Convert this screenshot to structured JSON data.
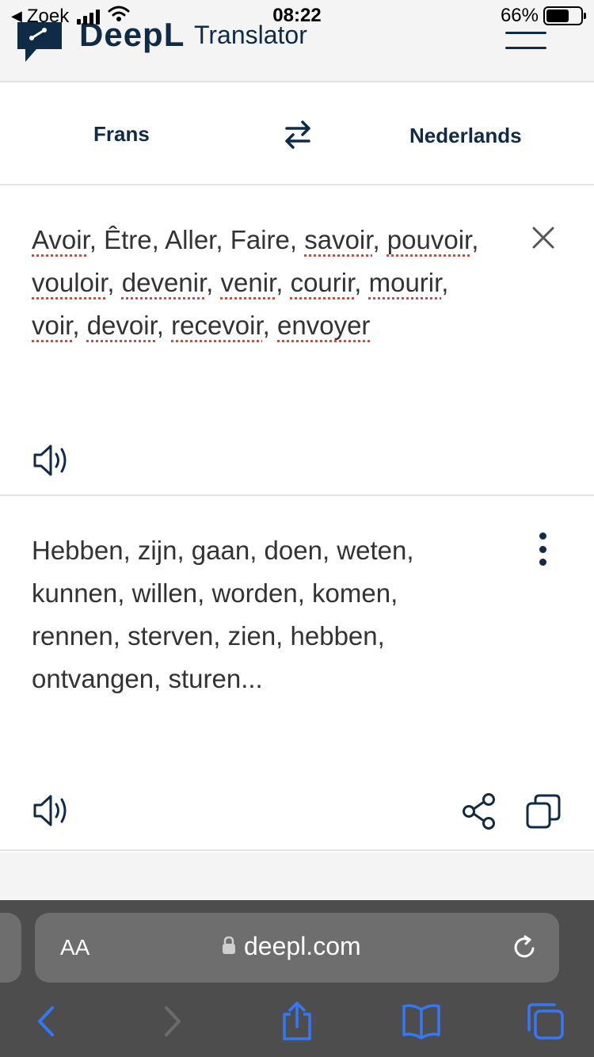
{
  "status_bar": {
    "back_label": "Zoek",
    "time": "08:22",
    "battery_percent": "66%",
    "battery_level": 0.66
  },
  "header": {
    "logo_text": "DeepL",
    "logo_subtitle": "Translator"
  },
  "languages": {
    "source": "Frans",
    "target": "Nederlands"
  },
  "source_panel": {
    "lines": [
      [
        {
          "t": "Avoir",
          "s": true
        },
        {
          "t": ", Être, Aller, Faire, ",
          "s": false
        },
        {
          "t": "savoir",
          "s": true
        },
        {
          "t": ", ",
          "s": false
        },
        {
          "t": "pouvoir",
          "s": true
        },
        {
          "t": ",",
          "s": false
        }
      ],
      [
        {
          "t": "vouloir",
          "s": true
        },
        {
          "t": ", ",
          "s": false
        },
        {
          "t": "devenir",
          "s": true
        },
        {
          "t": ", ",
          "s": false
        },
        {
          "t": "venir",
          "s": true
        },
        {
          "t": ", ",
          "s": false
        },
        {
          "t": "courir",
          "s": true
        },
        {
          "t": ", ",
          "s": false
        },
        {
          "t": "mourir",
          "s": true
        },
        {
          "t": ",",
          "s": false
        }
      ],
      [
        {
          "t": "voir",
          "s": true
        },
        {
          "t": ", ",
          "s": false
        },
        {
          "t": "devoir",
          "s": true
        },
        {
          "t": ", ",
          "s": false
        },
        {
          "t": "recevoir",
          "s": true
        },
        {
          "t": ", ",
          "s": false
        },
        {
          "t": "envoyer",
          "s": true
        }
      ]
    ]
  },
  "target_panel": {
    "lines": [
      "Hebben, zijn, gaan, doen, weten,",
      "kunnen, willen, worden, komen,",
      "rennen, sterven, zien, hebben,",
      "ontvangen, sturen..."
    ]
  },
  "browser": {
    "text_size_label": "AA",
    "url": "deepl.com"
  },
  "colors": {
    "brand": "#0f2b46",
    "safari_blue": "#3478f6",
    "spellcheck": "#e0443a"
  }
}
